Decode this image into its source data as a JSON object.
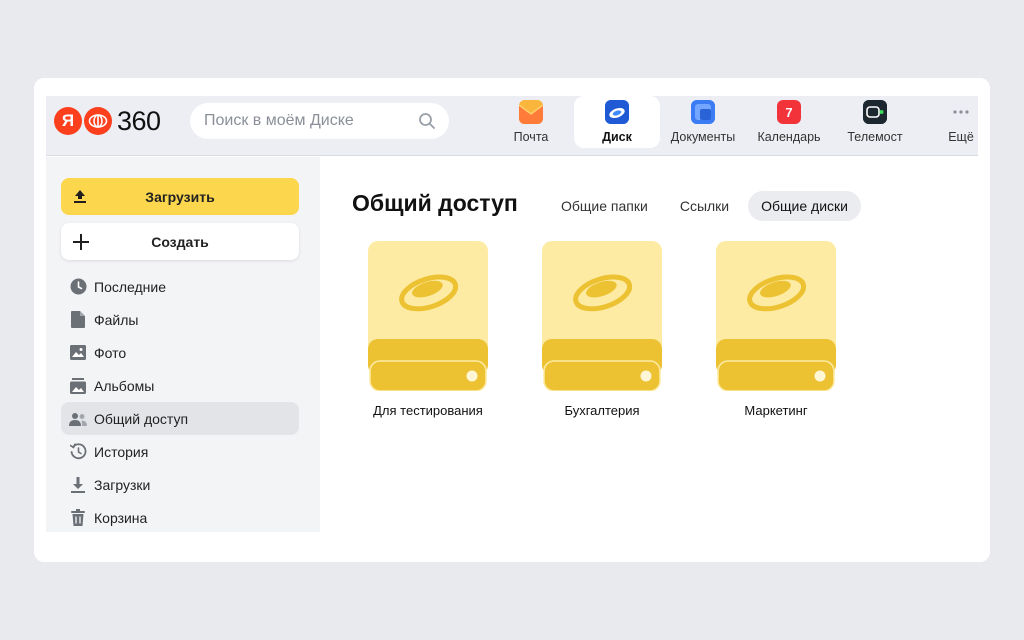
{
  "header": {
    "logo": {
      "letter": "Я",
      "number": "360"
    },
    "search": {
      "placeholder": "Поиск в моём Диске"
    },
    "services": [
      {
        "label": "Почта",
        "icon": "mail-icon",
        "color": "#f5a623",
        "active": false
      },
      {
        "label": "Диск",
        "icon": "disk-icon",
        "color": "#2f6fe0",
        "active": true
      },
      {
        "label": "Документы",
        "icon": "documents-icon",
        "color": "#4a86f5",
        "active": false
      },
      {
        "label": "Календарь",
        "icon": "calendar-icon",
        "color": "#f2343a",
        "badge": "7",
        "active": false
      },
      {
        "label": "Телемост",
        "icon": "telemost-icon",
        "color": "#1d2730",
        "active": false
      },
      {
        "label": "Ещё",
        "icon": "more-icon",
        "color": "#8a8f98",
        "active": false
      }
    ]
  },
  "sidebar": {
    "upload_label": "Загрузить",
    "create_label": "Создать",
    "items": [
      {
        "label": "Последние",
        "icon": "clock-icon",
        "active": false
      },
      {
        "label": "Файлы",
        "icon": "file-icon",
        "active": false
      },
      {
        "label": "Фото",
        "icon": "photo-icon",
        "active": false
      },
      {
        "label": "Альбомы",
        "icon": "albums-icon",
        "active": false
      },
      {
        "label": "Общий доступ",
        "icon": "people-icon",
        "active": true
      },
      {
        "label": "История",
        "icon": "history-icon",
        "active": false
      },
      {
        "label": "Загрузки",
        "icon": "download-icon",
        "active": false
      },
      {
        "label": "Корзина",
        "icon": "trash-icon",
        "active": false
      }
    ]
  },
  "main": {
    "title": "Общий доступ",
    "tabs": [
      {
        "label": "Общие папки",
        "active": false
      },
      {
        "label": "Ссылки",
        "active": false
      },
      {
        "label": "Общие диски",
        "active": true
      }
    ],
    "drives": [
      {
        "label": "Для тестирования"
      },
      {
        "label": "Бухгалтерия"
      },
      {
        "label": "Маркетинг"
      }
    ]
  },
  "colors": {
    "accent_yellow": "#fcd64c",
    "drive_light": "#fdeba4",
    "drive_dark": "#ecc232",
    "logo_red": "#fc3f1d"
  }
}
